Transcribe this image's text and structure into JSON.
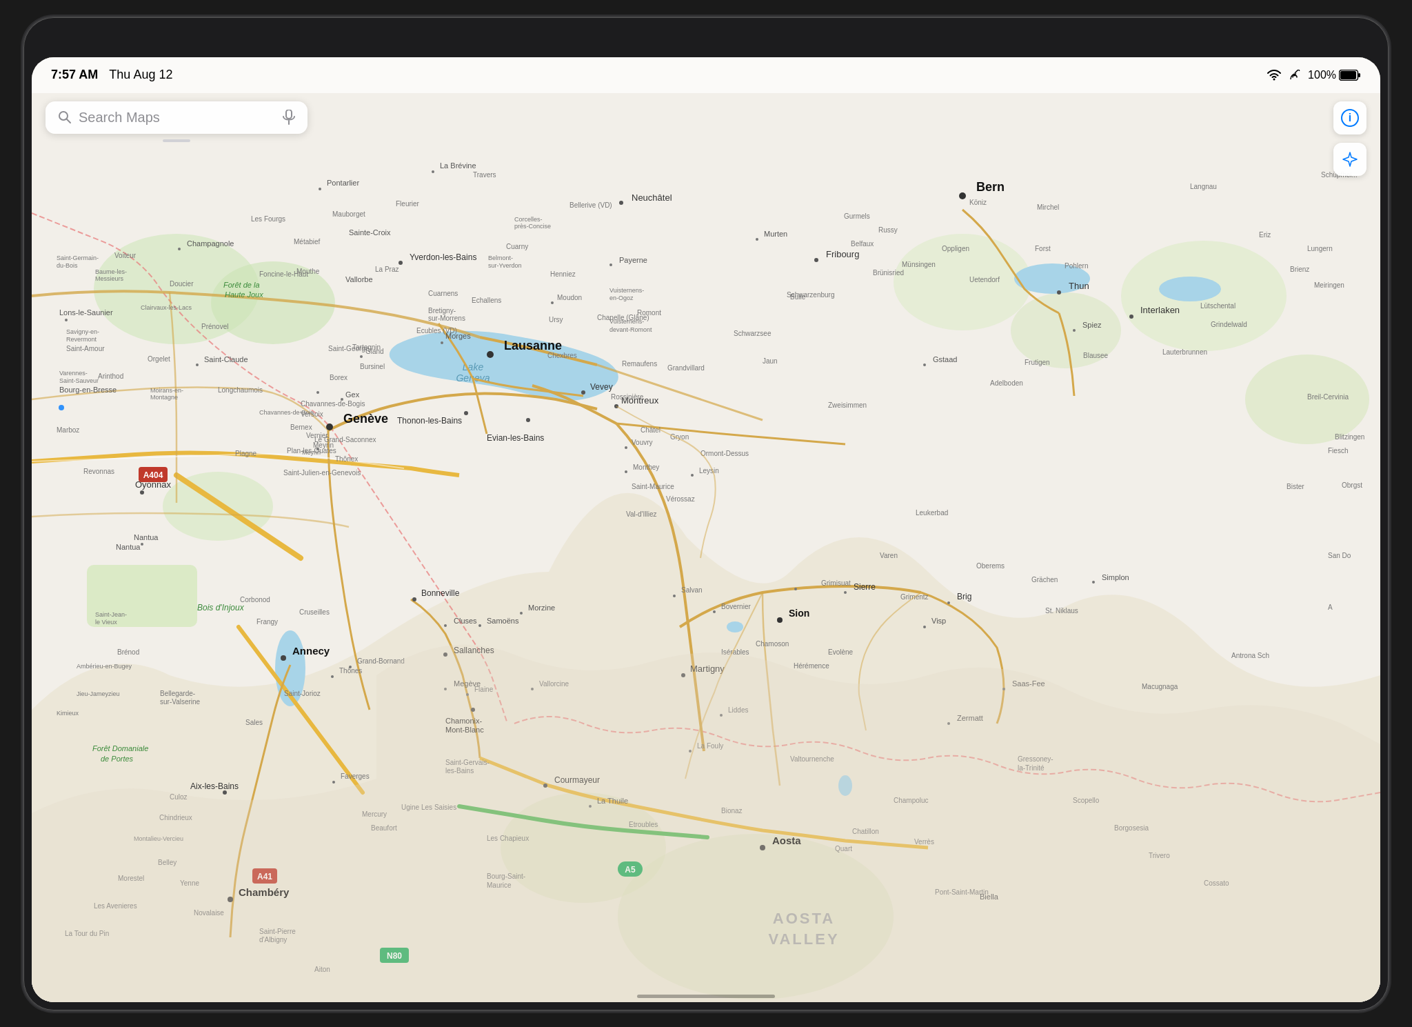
{
  "device": {
    "frame_color": "#1c1c1e"
  },
  "status_bar": {
    "time": "7:57 AM",
    "date": "Thu Aug 12",
    "battery_percent": "100%",
    "battery_full": true
  },
  "search": {
    "placeholder": "Search Maps"
  },
  "map_controls": {
    "info_label": "ℹ",
    "location_label": "➤"
  },
  "map": {
    "center": "Lake Geneva / Switzerland Region",
    "cities": [
      {
        "name": "Lausanne",
        "type": "major"
      },
      {
        "name": "Bern",
        "type": "major"
      },
      {
        "name": "Genève",
        "type": "major"
      },
      {
        "name": "Montreux",
        "type": "medium"
      },
      {
        "name": "Vevey",
        "type": "medium"
      },
      {
        "name": "Thonon-les-Bains",
        "type": "medium"
      },
      {
        "name": "Evian-les-Bains",
        "type": "medium"
      },
      {
        "name": "Annecy",
        "type": "medium"
      },
      {
        "name": "Martigny",
        "type": "medium"
      },
      {
        "name": "Sion",
        "type": "medium"
      },
      {
        "name": "Morges",
        "type": "small"
      },
      {
        "name": "Interlaken",
        "type": "small"
      },
      {
        "name": "Fribourg",
        "type": "medium"
      },
      {
        "name": "Payerne",
        "type": "small"
      },
      {
        "name": "Yverdon-les-Bains",
        "type": "small"
      },
      {
        "name": "Chamonix-Mont-Blanc",
        "type": "small"
      },
      {
        "name": "Bonneville",
        "type": "small"
      },
      {
        "name": "Sallanches",
        "type": "small"
      },
      {
        "name": "Chambéry",
        "type": "medium"
      },
      {
        "name": "Aosta",
        "type": "medium"
      },
      {
        "name": "Sierre",
        "type": "small"
      },
      {
        "name": "Zermatt",
        "type": "small"
      },
      {
        "name": "Saas-Fee",
        "type": "small"
      },
      {
        "name": "Gstaad",
        "type": "small"
      },
      {
        "name": "Thun",
        "type": "small"
      },
      {
        "name": "Brig",
        "type": "small"
      },
      {
        "name": "Visp",
        "type": "small"
      },
      {
        "name": "Samoëns",
        "type": "small"
      },
      {
        "name": "Cluses",
        "type": "small"
      },
      {
        "name": "Megève",
        "type": "small"
      },
      {
        "name": "Morzine",
        "type": "small"
      },
      {
        "name": "Courmayeur",
        "type": "small"
      },
      {
        "name": "La Thuile",
        "type": "small"
      },
      {
        "name": "Aix-les-Bains",
        "type": "small"
      },
      {
        "name": "Bellegarde-sur-Valserine",
        "type": "small"
      },
      {
        "name": "Oyonnax",
        "type": "small"
      },
      {
        "name": "Nantua",
        "type": "small"
      },
      {
        "name": "Lons-le-Saunier",
        "type": "small"
      },
      {
        "name": "Bourg-en-Bresse",
        "type": "small"
      },
      {
        "name": "AOSTA VALLEY",
        "type": "region"
      },
      {
        "name": "Pontarlier",
        "type": "small"
      },
      {
        "name": "Neuchâtel",
        "type": "medium"
      },
      {
        "name": "Murten",
        "type": "small"
      }
    ],
    "lake_name": "Lake Geneva",
    "highways": [
      "A404",
      "A41",
      "A5",
      "N80"
    ]
  },
  "home_bar": {
    "visible": true
  }
}
